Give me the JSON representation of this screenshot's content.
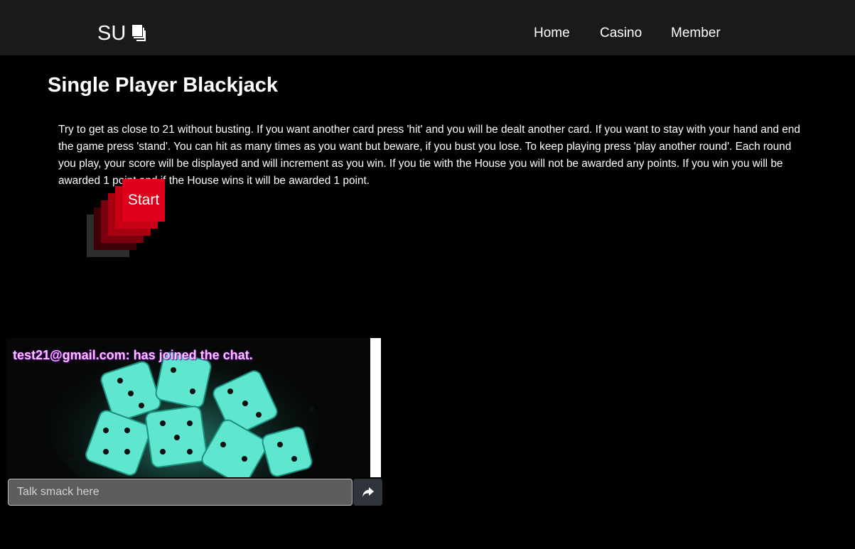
{
  "navbar": {
    "brand": "SU",
    "brand_icon": "stacked-cards-icon",
    "links": [
      {
        "label": "Home"
      },
      {
        "label": "Casino"
      },
      {
        "label": "Member"
      }
    ]
  },
  "page": {
    "title": "Single Player Blackjack",
    "instructions": "Try to get as close to 21 without busting. If you want another card press 'hit' and you will be dealt another card. If you want to stay with your hand and end the game press 'stand'. You can hit as many times as you want but beware, if you bust you lose. To keep playing press 'play another round'. Each round you play, your score will be displayed and will increment as you win. If you tie with the House you will not be awarded any points. If you win you will be awarded 1 point and if the House wins it will be awarded 1 point."
  },
  "game": {
    "start_label": "Start",
    "accent_color": "#e0001b"
  },
  "chat": {
    "messages": [
      {
        "text": "test21@gmail.com: has joined the chat."
      }
    ],
    "input_placeholder": "Talk smack here",
    "input_value": "",
    "send_icon": "share-arrow-icon",
    "background": "glowing-dice-image"
  }
}
